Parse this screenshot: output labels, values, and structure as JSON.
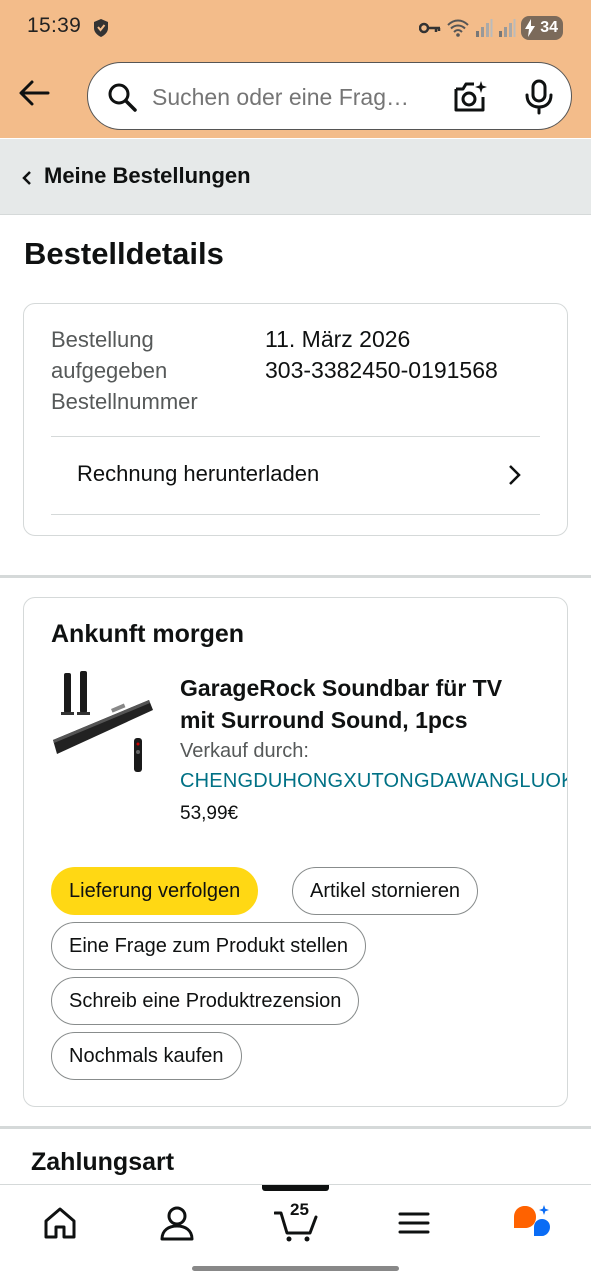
{
  "status_bar": {
    "time": "15:39",
    "battery": "34"
  },
  "search": {
    "placeholder": "Suchen oder eine Frag…"
  },
  "breadcrumb": {
    "label": "Meine Bestellungen"
  },
  "page": {
    "title": "Bestelldetails"
  },
  "order_info": {
    "placed_label_line1": "Bestellung",
    "placed_label_line2": "aufgegeben",
    "date": "11. März 2026",
    "number_label": "Bestellnummer",
    "number": "303-3382450-0191568",
    "invoice_label": "Rechnung herunterladen"
  },
  "shipment": {
    "arrival": "Ankunft morgen",
    "product_title": "GarageRock Soundbar für TV mit Surround Sound, 1pcs",
    "seller_label": "Verkauf durch:",
    "seller_name": "CHENGDUHONGXUTONGDAWANGLUOKEJI",
    "price": "53,99€",
    "actions": {
      "track": "Lieferung verfolgen",
      "cancel": "Artikel stornieren",
      "question": "Eine Frage zum Produkt stellen",
      "review": "Schreib eine Produktrezension",
      "rebuy": "Nochmals kaufen"
    }
  },
  "payment": {
    "title": "Zahlungsart"
  },
  "bottom_nav": {
    "cart_count": "25",
    "items": [
      "home-icon",
      "user-icon",
      "cart-icon",
      "menu-icon",
      "rufus-icon"
    ]
  },
  "colors": {
    "header_bg": "#F3BC8A",
    "primary_button": "#FFD814",
    "link": "#007185",
    "rufus_orange": "#FF6200",
    "rufus_blue": "#0A6CF5"
  }
}
